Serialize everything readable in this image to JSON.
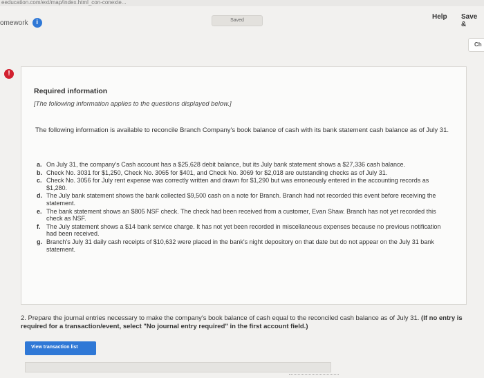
{
  "browser": {
    "url": "eeducation.com/ext/map/index.html_con-conexte..."
  },
  "header": {
    "homework_label": "omework",
    "info_icon_glyph": "i",
    "saved_label": "Saved",
    "help_label": "Help",
    "save_exit_label": "Save &",
    "side_button_label": "Ch"
  },
  "alert": {
    "glyph": "!"
  },
  "panel": {
    "title": "Required information",
    "subtitle": "[The following information applies to the questions displayed below.]",
    "intro": "The following information is available to reconcile Branch Company's book balance of cash with its bank statement cash balance as of July 31.",
    "items": [
      {
        "label": "a.",
        "text": "On July 31, the company's Cash account has a $25,628 debit balance, but its July bank statement shows a $27,336 cash balance."
      },
      {
        "label": "b.",
        "text": "Check No. 3031 for $1,250, Check No. 3065 for $401, and Check No. 3069 for $2,018 are outstanding checks as of July 31."
      },
      {
        "label": "c.",
        "text": "Check No. 3056 for July rent expense was correctly written and drawn for $1,290 but was erroneously entered in the accounting records as $1,280."
      },
      {
        "label": "d.",
        "text": "The July bank statement shows the bank collected $9,500 cash on a note for Branch. Branch had not recorded this event before receiving the statement."
      },
      {
        "label": "e.",
        "text": "The bank statement shows an $805 NSF check. The check had been received from a customer, Evan Shaw. Branch has not yet recorded this check as NSF."
      },
      {
        "label": "f.",
        "text": "The July statement shows a $14 bank service charge. It has not yet been recorded in miscellaneous expenses because no previous notification had been received."
      },
      {
        "label": "g.",
        "text": "Branch's July 31 daily cash receipts of $10,632 were placed in the bank's night depository on that date but do not appear on the July 31 bank statement."
      }
    ]
  },
  "question": {
    "text": "2. Prepare the journal entries necessary to make the company's book balance of cash equal to the reconciled cash balance as of July 31.",
    "instruction": "(If no entry is required for a transaction/event, select \"No journal entry required\" in the first account field.)"
  },
  "actions": {
    "view_transaction_list": "View transaction list"
  },
  "colors": {
    "accent": "#2f78d6",
    "alert": "#d2202f"
  }
}
